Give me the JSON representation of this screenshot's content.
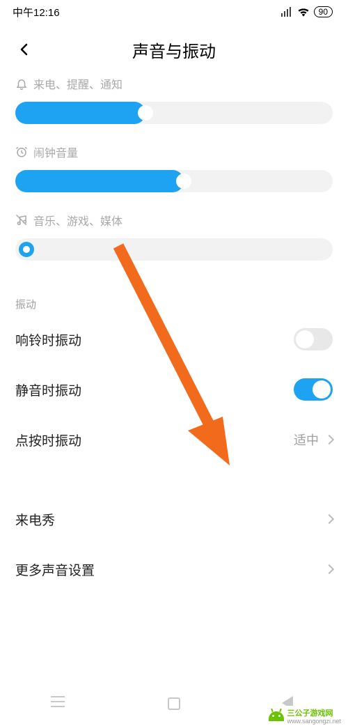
{
  "status": {
    "time": "中午12:16",
    "battery": "90"
  },
  "header": {
    "title": "声音与振动"
  },
  "sliders": {
    "ringer": {
      "label": "来电、提醒、通知",
      "percent": 41
    },
    "alarm": {
      "label": "闹钟音量",
      "percent": 53
    },
    "media": {
      "label": "音乐、游戏、媒体",
      "percent": 0
    }
  },
  "section": {
    "vibration": "振动"
  },
  "rows": {
    "vibrateOnRing": {
      "label": "响铃时振动",
      "on": false
    },
    "vibrateOnSilent": {
      "label": "静音时振动",
      "on": true
    },
    "tapVibrate": {
      "label": "点按时振动",
      "value": "适中"
    },
    "incomingShow": {
      "label": "来电秀"
    },
    "moreSound": {
      "label": "更多声音设置"
    }
  },
  "footer": {
    "brand": "三公子游戏网",
    "url": "www.sangongzi.net"
  }
}
